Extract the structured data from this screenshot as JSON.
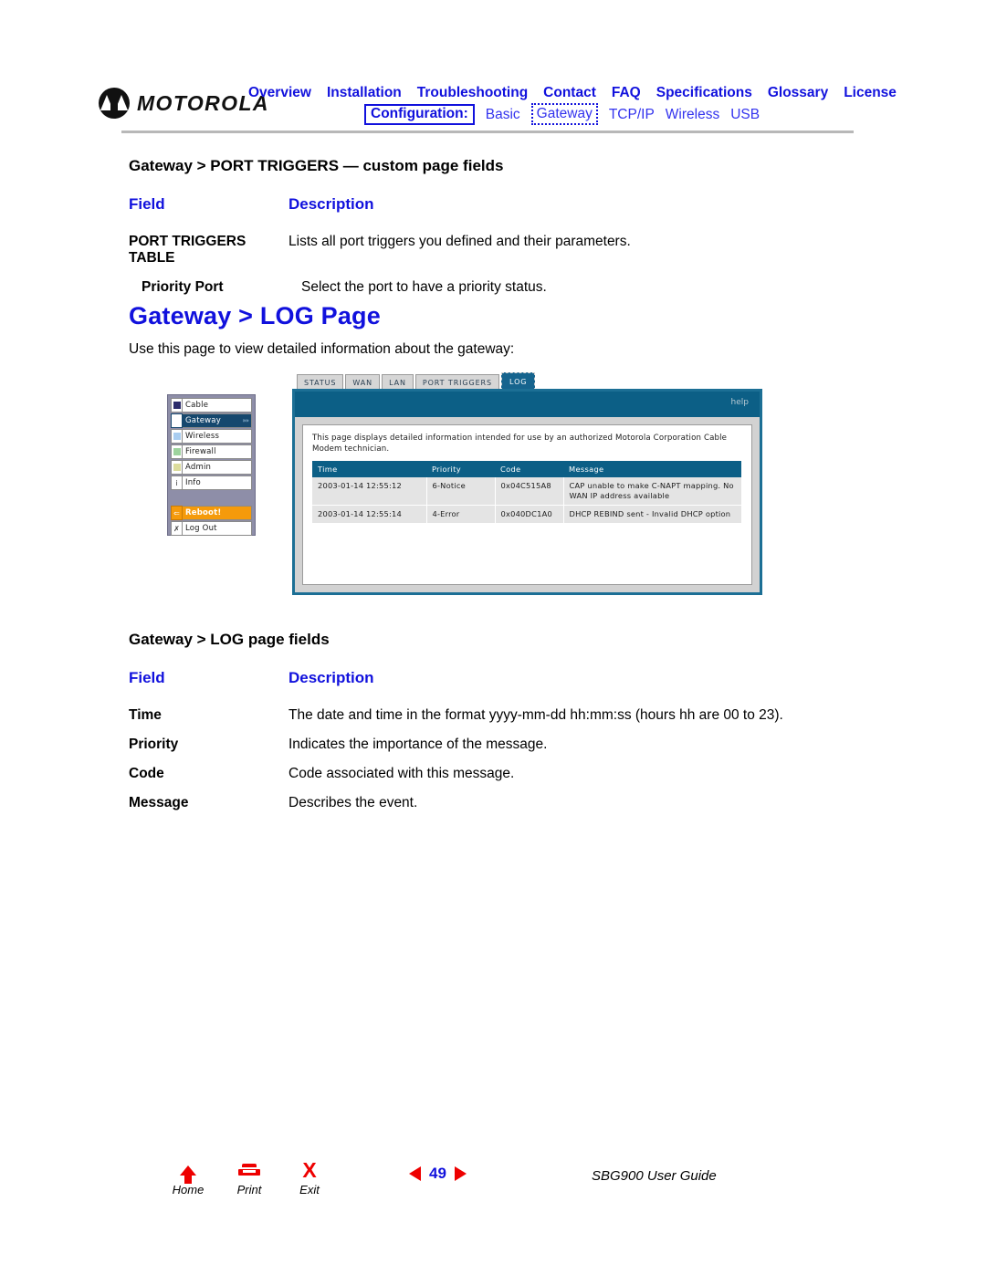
{
  "header": {
    "brand": "MOTOROLA",
    "nav_primary": [
      "Overview",
      "Installation",
      "Troubleshooting",
      "Contact",
      "FAQ",
      "Specifications",
      "Glossary",
      "License"
    ],
    "config_label": "Configuration:",
    "nav_secondary": [
      "Basic",
      "Gateway",
      "TCP/IP",
      "Wireless",
      "USB"
    ],
    "nav_secondary_active": "Gateway"
  },
  "section_port_triggers": {
    "heading": "Gateway > PORT TRIGGERS — custom page fields",
    "col_field": "Field",
    "col_description": "Description",
    "rows": [
      {
        "field": "PORT TRIGGERS TABLE",
        "description": "Lists all port triggers you defined and their parameters.",
        "indent": false
      },
      {
        "field": "Priority Port",
        "description": "Select the port to have a priority status.",
        "indent": true
      }
    ]
  },
  "page": {
    "title": "Gateway > LOG Page",
    "intro": "Use this page to view detailed information about the gateway:"
  },
  "screenshot": {
    "side_nav": [
      {
        "label": "Cable",
        "chip_color": "#2b2b6b",
        "state": "normal",
        "arrows": ""
      },
      {
        "label": "Gateway",
        "chip_color": "#ffffff",
        "state": "active",
        "arrows": "»»"
      },
      {
        "label": "Wireless",
        "chip_color": "#a9cdf0",
        "state": "normal",
        "arrows": ""
      },
      {
        "label": "Firewall",
        "chip_color": "#9dd39d",
        "state": "normal",
        "arrows": ""
      },
      {
        "label": "Admin",
        "chip_color": "#dcdc9b",
        "state": "normal",
        "arrows": ""
      },
      {
        "label": "Info",
        "chip_color": "",
        "chip_glyph": "i",
        "state": "normal",
        "arrows": ""
      }
    ],
    "side_nav_actions": [
      {
        "label": "Reboot!",
        "chip_glyph": "⇐",
        "state": "reboot"
      },
      {
        "label": "Log Out",
        "chip_glyph": "✗",
        "state": "normal"
      }
    ],
    "tabs": [
      {
        "label": "STATUS",
        "active": false
      },
      {
        "label": "WAN",
        "active": false
      },
      {
        "label": "LAN",
        "active": false
      },
      {
        "label": "PORT TRIGGERS",
        "active": false
      },
      {
        "label": "LOG",
        "active": true
      }
    ],
    "help_label": "help",
    "description": "This page displays detailed information intended for use by an authorized Motorola Corporation Cable Modem technician.",
    "log_table": {
      "columns": [
        "Time",
        "Priority",
        "Code",
        "Message"
      ],
      "rows": [
        [
          "2003-01-14 12:55:12",
          "6-Notice",
          "0x04C515A8",
          "CAP unable to make C-NAPT mapping. No WAN IP address available"
        ],
        [
          "2003-01-14 12:55:14",
          "4-Error",
          "0x040DC1A0",
          "DHCP REBIND sent - Invalid DHCP option"
        ]
      ]
    }
  },
  "section_log_fields": {
    "heading": "Gateway > LOG page fields",
    "col_field": "Field",
    "col_description": "Description",
    "rows": [
      {
        "field": "Time",
        "description": "The date and time in the format yyyy-mm-dd hh:mm:ss (hours hh are 00 to 23)."
      },
      {
        "field": "Priority",
        "description": "Indicates the importance of the message."
      },
      {
        "field": "Code",
        "description": "Code associated with this message."
      },
      {
        "field": "Message",
        "description": "Describes the event."
      }
    ]
  },
  "footer": {
    "home_label": "Home",
    "print_label": "Print",
    "exit_label": "Exit",
    "page_number": "49",
    "guide_label": "SBG900 User Guide"
  },
  "colors": {
    "link_blue": "#1111dd",
    "panel_blue": "#0c5f86",
    "panel_border": "#1c6f95",
    "accent_red": "#ee0000",
    "reboot_orange": "#f59a0b"
  }
}
